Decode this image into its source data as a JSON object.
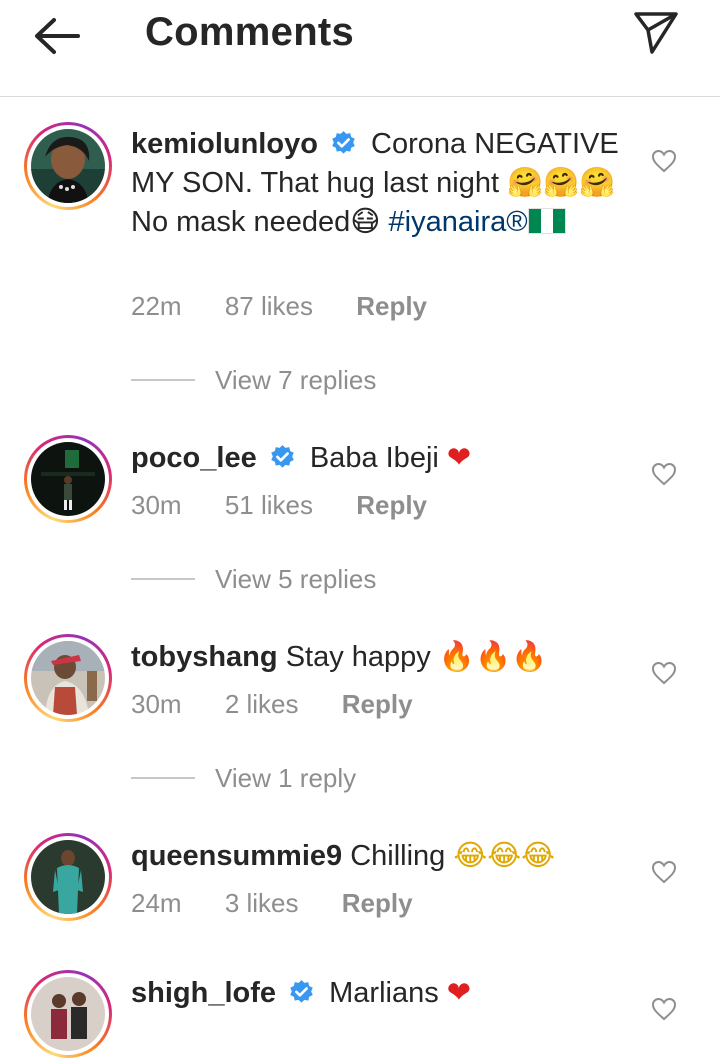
{
  "header": {
    "title": "Comments"
  },
  "comments": [
    {
      "username": "kemiolunloyo",
      "verified": true,
      "text_part1": "Corona NEGATIVE MY SON. That hug last night ",
      "emojis1": "🤗🤗🤗",
      "text_part2": " No mask needed",
      "emojis2": "😷",
      "hashtag": "#iyanaira®",
      "time": "22m",
      "likes": "87 likes",
      "reply": "Reply",
      "view_replies": "View 7 replies"
    },
    {
      "username": "poco_lee",
      "verified": true,
      "text": "Baba Ibeji",
      "emoji": "❤",
      "time": "30m",
      "likes": "51 likes",
      "reply": "Reply",
      "view_replies": "View 5 replies"
    },
    {
      "username": "tobyshang",
      "verified": false,
      "text": "Stay happy",
      "emoji": "🔥🔥🔥",
      "time": "30m",
      "likes": "2 likes",
      "reply": "Reply",
      "view_replies": "View 1 reply"
    },
    {
      "username": "queensummie9",
      "verified": false,
      "text": "Chilling",
      "emoji": "😂😂😂",
      "time": "24m",
      "likes": "3 likes",
      "reply": "Reply"
    },
    {
      "username": "shigh_lofe",
      "verified": true,
      "text": "Marlians",
      "emoji": "❤"
    }
  ],
  "colors": {
    "verified": "#3897f0",
    "heart_red": "#e02020",
    "hashtag": "#00376b",
    "meta": "#8e8e8e"
  }
}
